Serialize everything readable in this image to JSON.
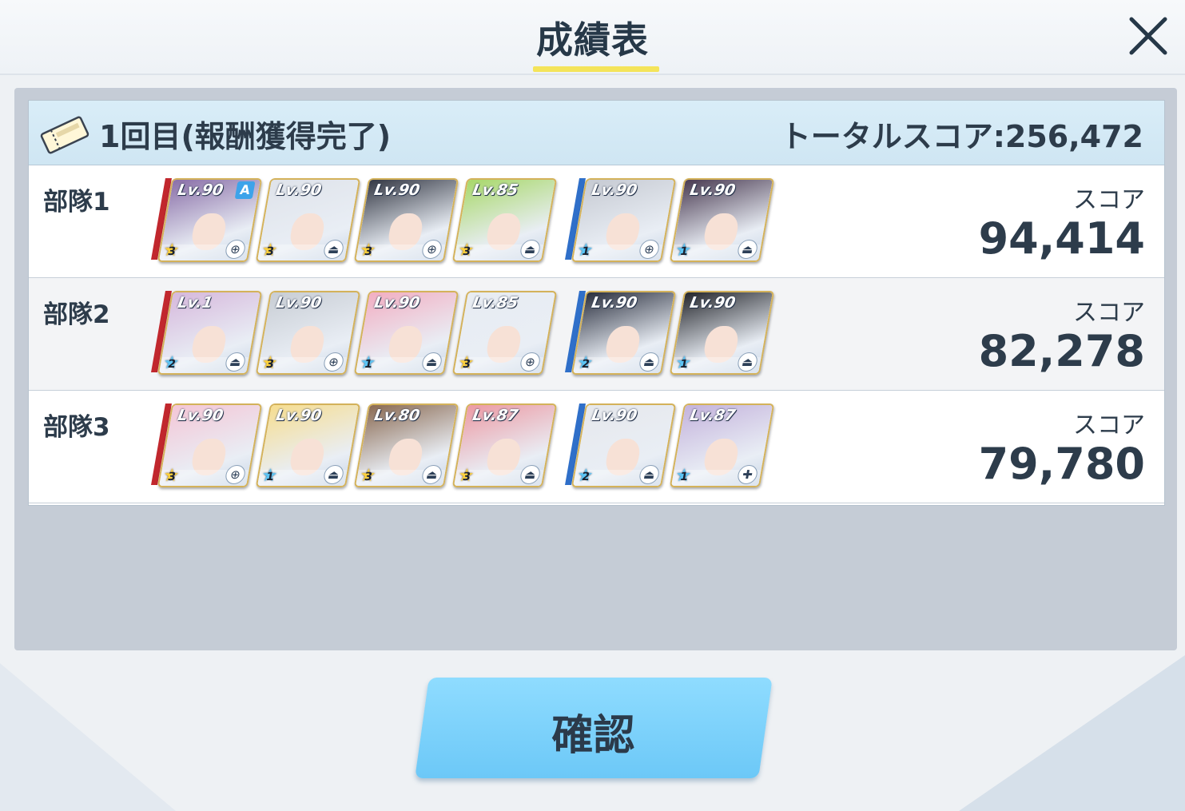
{
  "header": {
    "title": "成績表",
    "close_icon": "close-icon"
  },
  "round": {
    "label": "1回目(報酬獲得完了)",
    "total": "トータルスコア:256,472"
  },
  "teams": [
    {
      "name": "部隊1",
      "score_label": "スコア",
      "score": "94,414",
      "strikers": [
        {
          "level": "Lv.90",
          "stars": "3",
          "role": "crosshair-icon",
          "tag": "A",
          "color": "#8a6fa8"
        },
        {
          "level": "Lv.90",
          "stars": "3",
          "role": "tank-icon",
          "color": "#dfe3ea"
        },
        {
          "level": "Lv.90",
          "stars": "3",
          "role": "crosshair-icon",
          "color": "#343844"
        },
        {
          "level": "Lv.85",
          "stars": "3",
          "role": "tank-icon",
          "color": "#a8d86a"
        }
      ],
      "specials": [
        {
          "level": "Lv.90",
          "stars": "1",
          "role": "crosshair-icon",
          "color": "#c6cad2"
        },
        {
          "level": "Lv.90",
          "stars": "1",
          "role": "tank-icon",
          "color": "#4a3b52"
        }
      ]
    },
    {
      "name": "部隊2",
      "score_label": "スコア",
      "score": "82,278",
      "strikers": [
        {
          "level": "Lv.1",
          "stars": "2",
          "role": "tank-icon",
          "color": "#d6b8dc"
        },
        {
          "level": "Lv.90",
          "stars": "3",
          "role": "crosshair-icon",
          "color": "#c8cdd4"
        },
        {
          "level": "Lv.90",
          "stars": "1",
          "role": "tank-icon",
          "color": "#f2aec2"
        },
        {
          "level": "Lv.85",
          "stars": "3",
          "role": "crosshair-icon",
          "color": "#e8ecf2"
        }
      ],
      "specials": [
        {
          "level": "Lv.90",
          "stars": "2",
          "role": "tank-icon",
          "color": "#2a2f3e"
        },
        {
          "level": "Lv.90",
          "stars": "1",
          "role": "tank-icon",
          "color": "#24262c"
        }
      ]
    },
    {
      "name": "部隊3",
      "score_label": "スコア",
      "score": "79,780",
      "strikers": [
        {
          "level": "Lv.90",
          "stars": "3",
          "role": "crosshair-icon",
          "color": "#f4c6d6"
        },
        {
          "level": "Lv.90",
          "stars": "1",
          "role": "tank-icon",
          "color": "#f6dd90"
        },
        {
          "level": "Lv.80",
          "stars": "3",
          "role": "tank-icon",
          "color": "#8a6a52"
        },
        {
          "level": "Lv.87",
          "stars": "3",
          "role": "tank-icon",
          "color": "#ec9aa4"
        }
      ],
      "specials": [
        {
          "level": "Lv.90",
          "stars": "2",
          "role": "tank-icon",
          "color": "#e6e8ec"
        },
        {
          "level": "Lv.87",
          "stars": "1",
          "role": "heal-icon",
          "color": "#c4b3dc"
        }
      ]
    }
  ],
  "footer": {
    "confirm_label": "確認"
  },
  "colors": {
    "accent_underline": "#f4e45a",
    "confirm_button": "#7fd3fb",
    "striker_bar": "#c1272d",
    "special_bar": "#2f6fc9"
  }
}
